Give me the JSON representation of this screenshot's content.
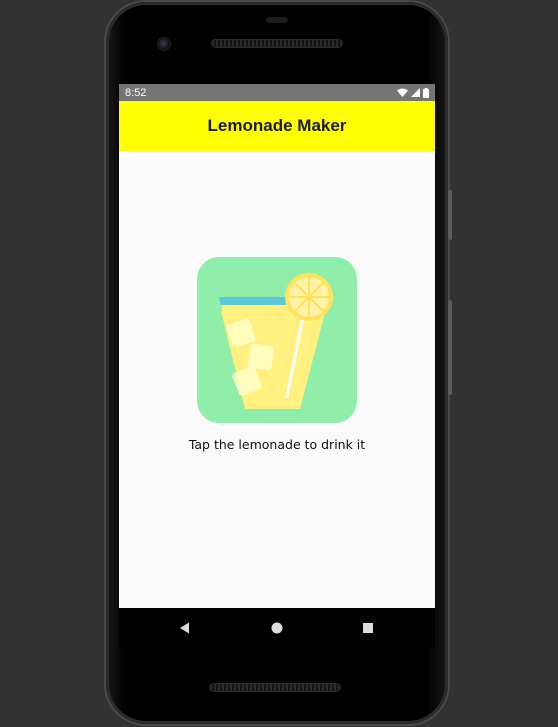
{
  "status_bar": {
    "time": "8:52",
    "icons": [
      "wifi-icon",
      "signal-icon",
      "battery-icon"
    ]
  },
  "app_bar": {
    "title": "Lemonade Maker"
  },
  "main": {
    "image_icon": "lemonade-glass-icon",
    "instruction": "Tap the lemonade to drink it"
  },
  "nav_bar": {
    "buttons": [
      "back-icon",
      "home-icon",
      "recents-icon"
    ]
  },
  "colors": {
    "app_bar_bg": "#ffff00",
    "image_bg": "#8eeeaa",
    "status_bar_bg": "#757575",
    "screen_bg": "#fafafa"
  }
}
